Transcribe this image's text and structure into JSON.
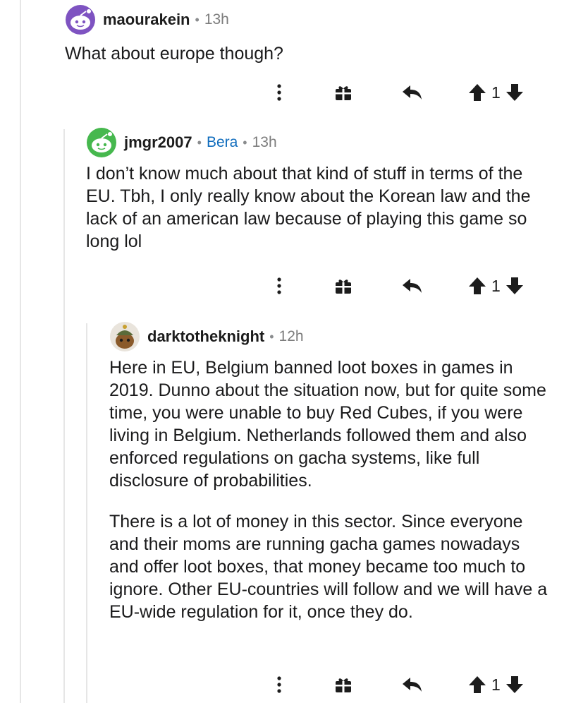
{
  "comments": [
    {
      "username": "maourakein",
      "time": "13h",
      "flair": "",
      "body": [
        "What about europe though?"
      ],
      "score": "1"
    },
    {
      "username": "jmgr2007",
      "time": "13h",
      "flair": "Bera",
      "body": [
        "I don’t know much about that kind of stuff in terms of the EU. Tbh, I only really know about the Korean law and the lack of an american law because of playing this game so long lol"
      ],
      "score": "1"
    },
    {
      "username": "darktotheknight",
      "time": "12h",
      "flair": "",
      "body": [
        "Here in EU, Belgium banned loot boxes in games in 2019. Dunno about the situation now, but for quite some time, you were unable to buy Red Cubes, if you were living in Belgium. Netherlands followed them and also enforced regulations on gacha systems, like full disclosure of probabilities.",
        "There is a lot of money in this sector. Since everyone and their moms are running gacha games nowadays and offer loot boxes, that money became too much to ignore. Other EU-countries will follow and we will have a EU-wide regulation for it, once they do."
      ],
      "score": "1"
    }
  ],
  "separator": "•",
  "icons": {
    "more": "more-vertical-icon",
    "award": "gift-award-icon",
    "reply": "reply-arrow-icon",
    "upvote": "upvote-arrow-icon",
    "downvote": "downvote-arrow-icon"
  },
  "colors": {
    "text": "#1a1a1b",
    "meta": "#7c7c7c",
    "flair": "#0f6cbd",
    "thread_line": "#e6e6e6",
    "icon": "#1c1c1c"
  }
}
